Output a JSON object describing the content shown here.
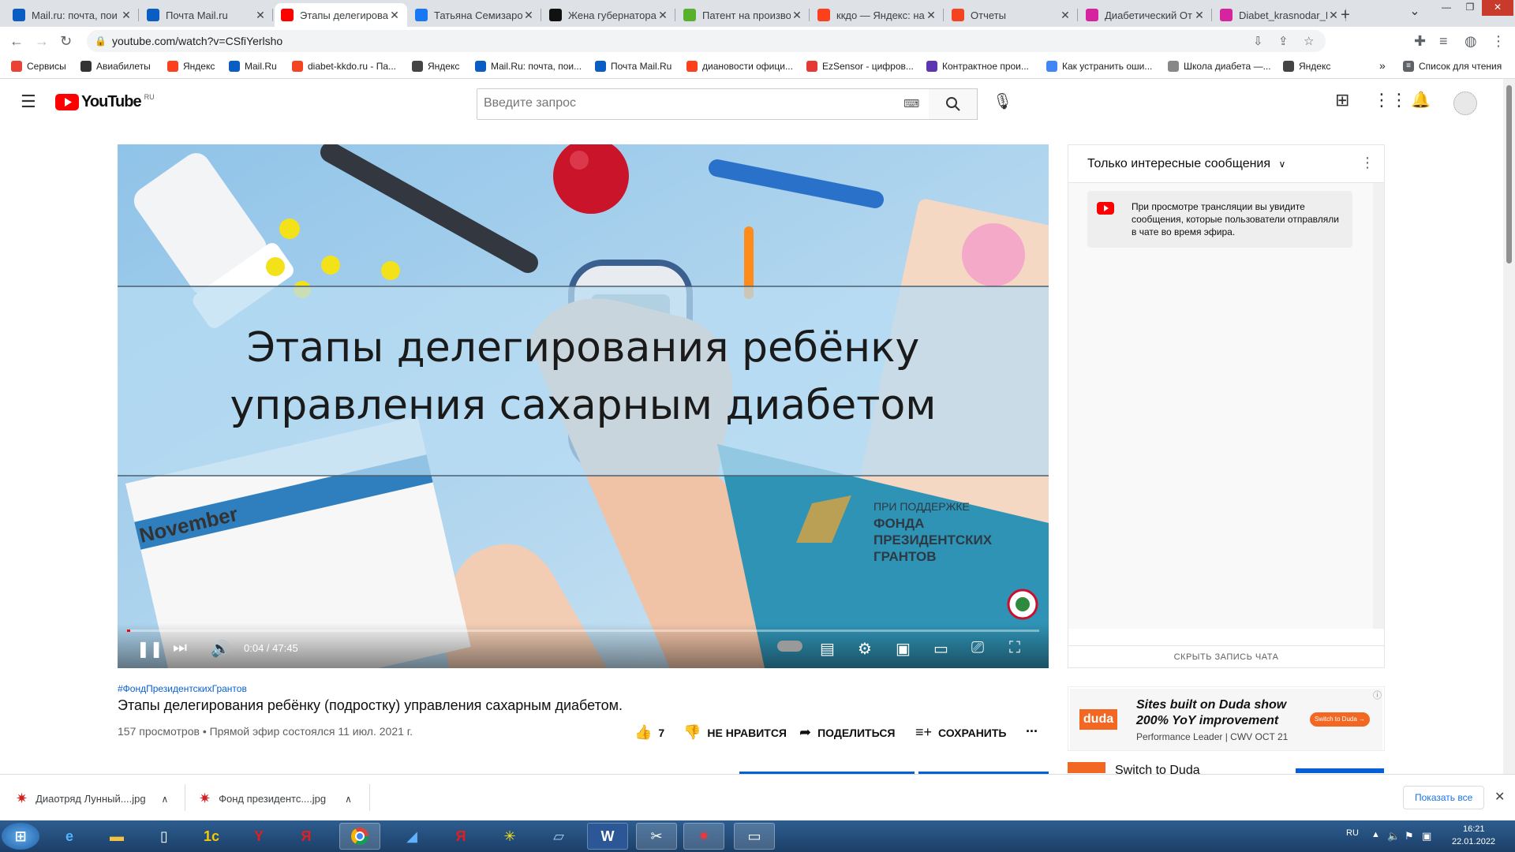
{
  "browser": {
    "tabs": [
      {
        "title": "Mail.ru: почта, пои",
        "favicon": "mailru-icon",
        "color": "#0a5dc2",
        "active": false
      },
      {
        "title": "Почта Mail.ru",
        "favicon": "mail-envelope-icon",
        "color": "#0a5dc2",
        "active": false
      },
      {
        "title": "Этапы делегирова",
        "favicon": "youtube-icon",
        "color": "#ff0000",
        "active": true
      },
      {
        "title": "Татьяна Семизаро",
        "favicon": "facebook-icon",
        "color": "#1877f2",
        "active": false
      },
      {
        "title": "Жена губернатора",
        "favicon": "m-icon",
        "color": "#111111",
        "active": false
      },
      {
        "title": "Патент на произво",
        "favicon": "d-icon",
        "color": "#57b12d",
        "active": false
      },
      {
        "title": "ккдо — Яндекс: на",
        "favicon": "yandex-icon",
        "color": "#fc3f1d",
        "active": false
      },
      {
        "title": "Отчеты",
        "favicon": "joomla-icon",
        "color": "#f44321",
        "active": false
      },
      {
        "title": "Диабетический От",
        "favicon": "instagram-icon",
        "color": "#d6249f",
        "active": false
      },
      {
        "title": "Diabet_krasnodar_F",
        "favicon": "instagram-icon",
        "color": "#d6249f",
        "active": false
      }
    ],
    "new_tab": "+",
    "url": "youtube.com/watch?v=CSfiYerlsho",
    "bookmarks": [
      {
        "label": "Сервисы",
        "color": "#ea4335"
      },
      {
        "label": "Авиабилеты",
        "color": "#333333"
      },
      {
        "label": "Яндекс",
        "color": "#fc3f1d"
      },
      {
        "label": "Mail.Ru",
        "color": "#0a5dc2"
      },
      {
        "label": "diabet-kkdo.ru - Па...",
        "color": "#f44321"
      },
      {
        "label": "Яндекс",
        "color": "#444444"
      },
      {
        "label": "Mail.Ru: почта, пои...",
        "color": "#0a5dc2"
      },
      {
        "label": "Почта Mail.Ru",
        "color": "#0a5dc2"
      },
      {
        "label": "диановости офици...",
        "color": "#fc3f1d"
      },
      {
        "label": "EzSensor - цифров...",
        "color": "#e53935"
      },
      {
        "label": "Контрактное прои...",
        "color": "#5e35b1"
      },
      {
        "label": "Как устранить оши...",
        "color": "#4285f4"
      },
      {
        "label": "Школа диабета —...",
        "color": "#888888"
      },
      {
        "label": "Яндекс",
        "color": "#444444"
      }
    ],
    "more_bookmarks": "»",
    "reading_list": "Список для чтения"
  },
  "youtube": {
    "logo_text": "YouTube",
    "region": "RU",
    "search_placeholder": "Введите запрос",
    "video": {
      "overlay_line1": "Этапы делегирования ребёнку",
      "overlay_line2": "управления сахарным диабетом",
      "calendar_month": "November",
      "sponsor_line1": "ПРИ ПОДДЕРЖКЕ",
      "sponsor_line2": "ФОНДА",
      "sponsor_line3": "ПРЕЗИДЕНТСКИХ",
      "sponsor_line4": "ГРАНТОВ",
      "time": "0:04 / 47:45",
      "progress": 0.0014
    },
    "hashtag": "#ФондПрезидентскихГрантов",
    "title": "Этапы делегирования ребёнку (подростку) управления сахарным диабетом.",
    "meta": "157 просмотров • Прямой эфир состоялся 11 июл. 2021 г.",
    "likes": "7",
    "dislike_label": "НЕ НРАВИТСЯ",
    "share_label": "ПОДЕЛИТЬСЯ",
    "save_label": "СОХРАНИТЬ",
    "more": "...",
    "chat": {
      "header": "Только интересные сообщения",
      "message": "При просмотре трансляции вы увидите сообщения, которые пользователи отправляли в чате во время эфира.",
      "hide": "СКРЫТЬ ЗАПИСЬ ЧАТА"
    },
    "ad": {
      "brand": "duda",
      "headline1": "Sites built on Duda show",
      "headline2": "200% YoY improvement",
      "sub": "Performance Leader | CWV OCT 21",
      "cta": "Switch to Duda →",
      "next_title": "Switch to Duda"
    }
  },
  "downloads": {
    "items": [
      "Диаотряд Лунный....jpg",
      "Фонд президентс....jpg"
    ],
    "show_all": "Показать все"
  },
  "taskbar": {
    "lang": "RU",
    "time": "16:21",
    "date": "22.01.2022"
  }
}
